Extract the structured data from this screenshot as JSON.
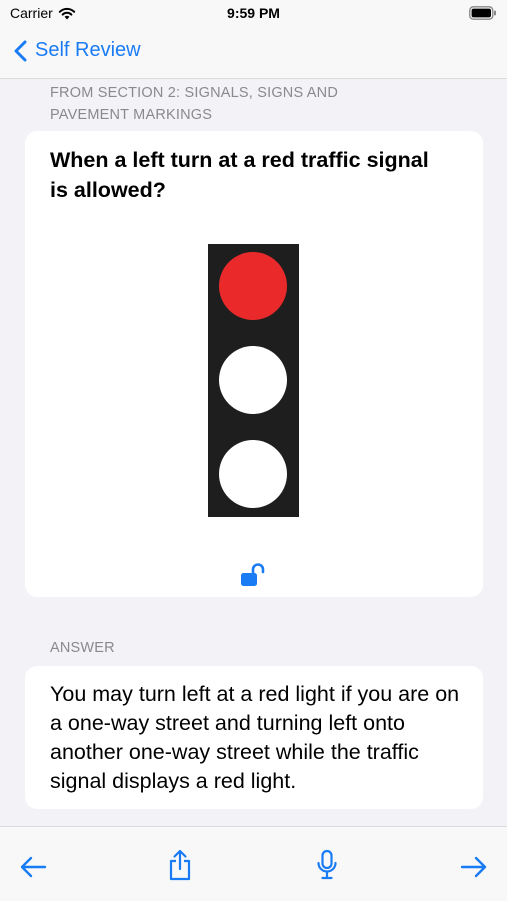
{
  "status_bar": {
    "carrier": "Carrier",
    "time": "9:59 PM"
  },
  "nav": {
    "back_label": "Self Review"
  },
  "question": {
    "section": "FROM SECTION 2: SIGNALS, SIGNS AND PAVEMENT MARKINGS",
    "text": "When a left turn at a red traffic signal is allowed?",
    "traffic_light_lamps": [
      "red",
      "white",
      "white"
    ],
    "lamp_colors": {
      "red": "#ea2a2a",
      "white": "#ffffff"
    }
  },
  "answer": {
    "label": "ANSWER",
    "text": "You may turn left at a red light if you are on a one-way street and turning left onto another one-way street while the traffic signal displays a red light."
  },
  "toolbar": {
    "items": [
      "back-arrow-icon",
      "share-icon",
      "microphone-icon",
      "forward-arrow-icon"
    ]
  },
  "colors": {
    "accent": "#1a7cf5",
    "background": "#f2f2f7",
    "card": "#ffffff",
    "secondary_text": "#8a8a8e"
  }
}
